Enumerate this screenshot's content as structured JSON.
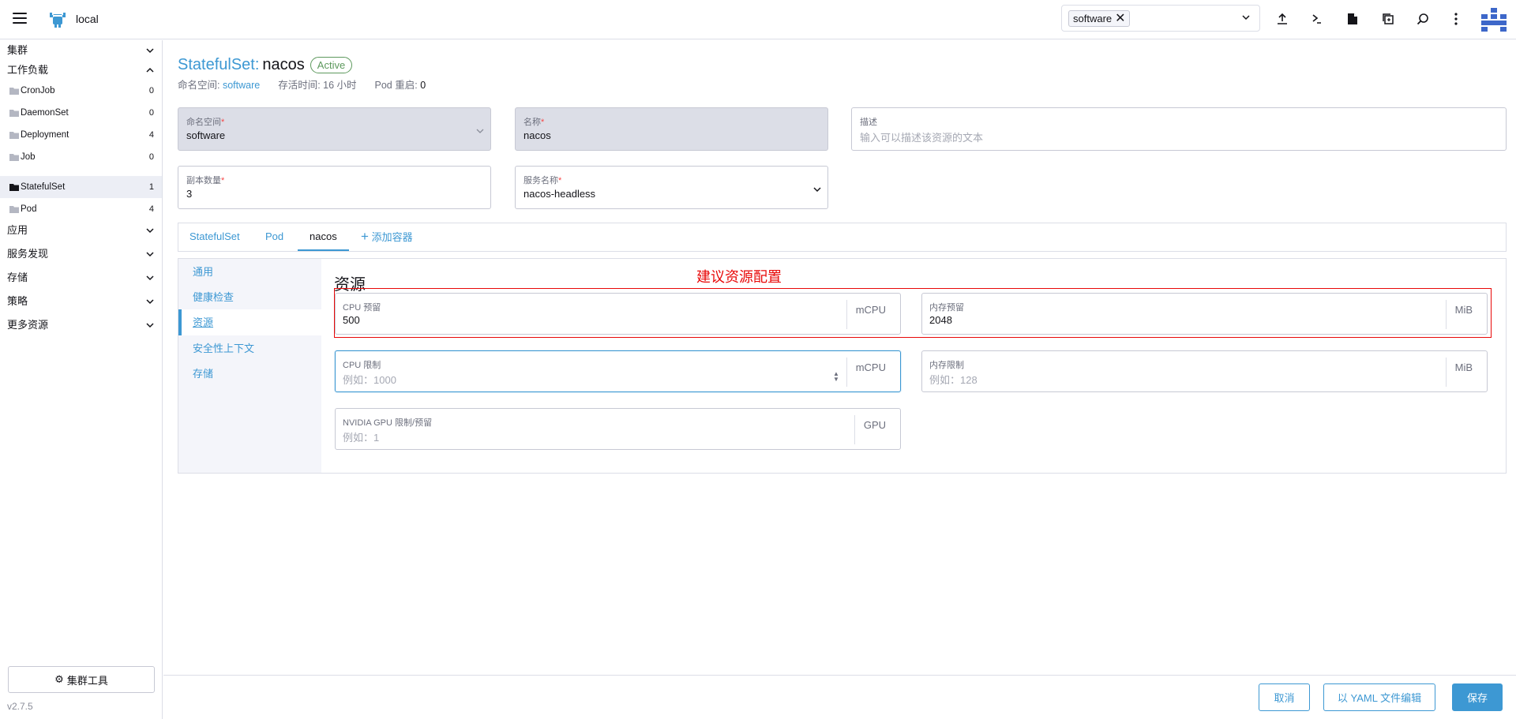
{
  "header": {
    "cluster_name": "local",
    "namespace_chip": "software"
  },
  "sidebar": {
    "groups": {
      "cluster": "集群",
      "workloads": "工作负载",
      "apps": "应用",
      "service_discovery": "服务发现",
      "storage": "存储",
      "policy": "策略",
      "more_resources": "更多资源"
    },
    "workload_items": [
      {
        "label": "CronJob",
        "count": "0"
      },
      {
        "label": "DaemonSet",
        "count": "0"
      },
      {
        "label": "Deployment",
        "count": "4"
      },
      {
        "label": "Job",
        "count": "0"
      },
      {
        "label": "StatefulSet",
        "count": "1"
      },
      {
        "label": "Pod",
        "count": "4"
      }
    ],
    "cluster_tools": "集群工具",
    "version": "v2.7.5"
  },
  "page": {
    "kind": "StatefulSet:",
    "name": "nacos",
    "status": "Active",
    "namespace_label": "命名空间:",
    "namespace_value": "software",
    "age_label": "存活时间:",
    "age_value": "16 小时",
    "restarts_label": "Pod 重启:",
    "restarts_value": "0"
  },
  "form": {
    "namespace": {
      "label": "命名空间",
      "value": "software"
    },
    "name": {
      "label": "名称",
      "value": "nacos"
    },
    "description": {
      "label": "描述",
      "placeholder": "输入可以描述该资源的文本"
    },
    "replicas": {
      "label": "副本数量",
      "value": "3"
    },
    "service_name": {
      "label": "服务名称",
      "value": "nacos-headless"
    }
  },
  "tabs": {
    "statefulset": "StatefulSet",
    "pod": "Pod",
    "nacos": "nacos",
    "add_container": "添加容器"
  },
  "container_nav": {
    "general": "通用",
    "health": "健康检查",
    "resources": "资源",
    "security": "安全性上下文",
    "storage": "存储"
  },
  "resources": {
    "title": "资源",
    "annotation": "建议资源配置",
    "cpu_reservation": {
      "label": "CPU 预留",
      "value": "500",
      "unit": "mCPU"
    },
    "memory_reservation": {
      "label": "内存预留",
      "value": "2048",
      "unit": "MiB"
    },
    "cpu_limit": {
      "label": "CPU 限制",
      "placeholder": "例如：1000",
      "unit": "mCPU"
    },
    "memory_limit": {
      "label": "内存限制",
      "placeholder": "例如：128",
      "unit": "MiB"
    },
    "gpu": {
      "label": "NVIDIA GPU 限制/预留",
      "placeholder": "例如：1",
      "unit": "GPU"
    }
  },
  "footer": {
    "cancel": "取消",
    "edit_yaml": "以 YAML 文件编辑",
    "save": "保存"
  },
  "colors": {
    "accent": "#3d98d3",
    "active_green": "#5d995d",
    "annotation_red": "#e80808",
    "required_red": "#f64747"
  }
}
